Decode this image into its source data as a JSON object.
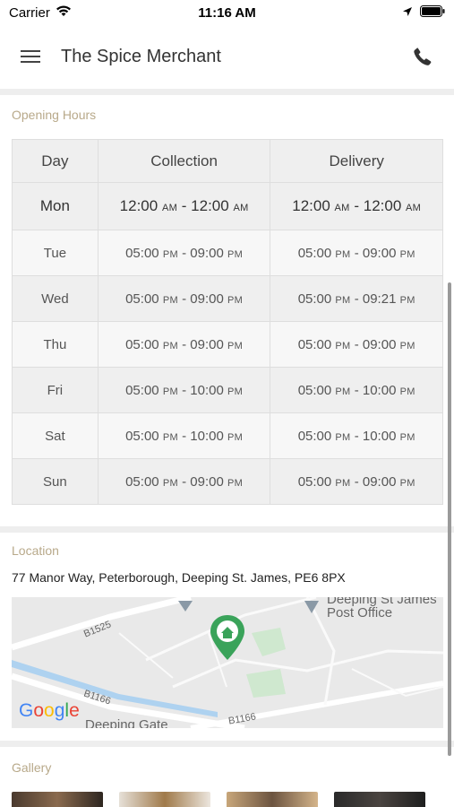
{
  "status_bar": {
    "carrier": "Carrier",
    "time": "11:16 AM"
  },
  "nav": {
    "title": "The Spice Merchant",
    "menu_icon": "hamburger-menu-icon",
    "call_icon": "phone-icon"
  },
  "opening_hours": {
    "label": "Opening Hours",
    "headers": [
      "Day",
      "Collection",
      "Delivery"
    ],
    "rows": [
      {
        "day": "Mon",
        "col_from": "12:00",
        "col_from_ampm": "AM",
        "col_to": "12:00",
        "col_to_ampm": "AM",
        "del_from": "12:00",
        "del_from_ampm": "AM",
        "del_to": "12:00",
        "del_to_ampm": "AM"
      },
      {
        "day": "Tue",
        "col_from": "05:00",
        "col_from_ampm": "PM",
        "col_to": "09:00",
        "col_to_ampm": "PM",
        "del_from": "05:00",
        "del_from_ampm": "PM",
        "del_to": "09:00",
        "del_to_ampm": "PM"
      },
      {
        "day": "Wed",
        "col_from": "05:00",
        "col_from_ampm": "PM",
        "col_to": "09:00",
        "col_to_ampm": "PM",
        "del_from": "05:00",
        "del_from_ampm": "PM",
        "del_to": "09:21",
        "del_to_ampm": "PM"
      },
      {
        "day": "Thu",
        "col_from": "05:00",
        "col_from_ampm": "PM",
        "col_to": "09:00",
        "col_to_ampm": "PM",
        "del_from": "05:00",
        "del_from_ampm": "PM",
        "del_to": "09:00",
        "del_to_ampm": "PM"
      },
      {
        "day": "Fri",
        "col_from": "05:00",
        "col_from_ampm": "PM",
        "col_to": "10:00",
        "col_to_ampm": "PM",
        "del_from": "05:00",
        "del_from_ampm": "PM",
        "del_to": "10:00",
        "del_to_ampm": "PM"
      },
      {
        "day": "Sat",
        "col_from": "05:00",
        "col_from_ampm": "PM",
        "col_to": "10:00",
        "col_to_ampm": "PM",
        "del_from": "05:00",
        "del_from_ampm": "PM",
        "del_to": "10:00",
        "del_to_ampm": "PM"
      },
      {
        "day": "Sun",
        "col_from": "05:00",
        "col_from_ampm": "PM",
        "col_to": "09:00",
        "col_to_ampm": "PM",
        "del_from": "05:00",
        "del_from_ampm": "PM",
        "del_to": "09:00",
        "del_to_ampm": "PM"
      }
    ]
  },
  "location": {
    "label": "Location",
    "address": "77 Manor Way, Peterborough, Deeping St. James, PE6 8PX",
    "map": {
      "road_labels": [
        "B1525",
        "B1166",
        "B1166"
      ],
      "place_labels": [
        "Deeping St James",
        "Post Office",
        "Deeping Gate"
      ],
      "brand": "Google",
      "marker_icon": "home-marker-icon"
    }
  },
  "gallery": {
    "label": "Gallery"
  },
  "colors": {
    "section_label": "#b8a98a",
    "marker": "#3aa35a"
  }
}
